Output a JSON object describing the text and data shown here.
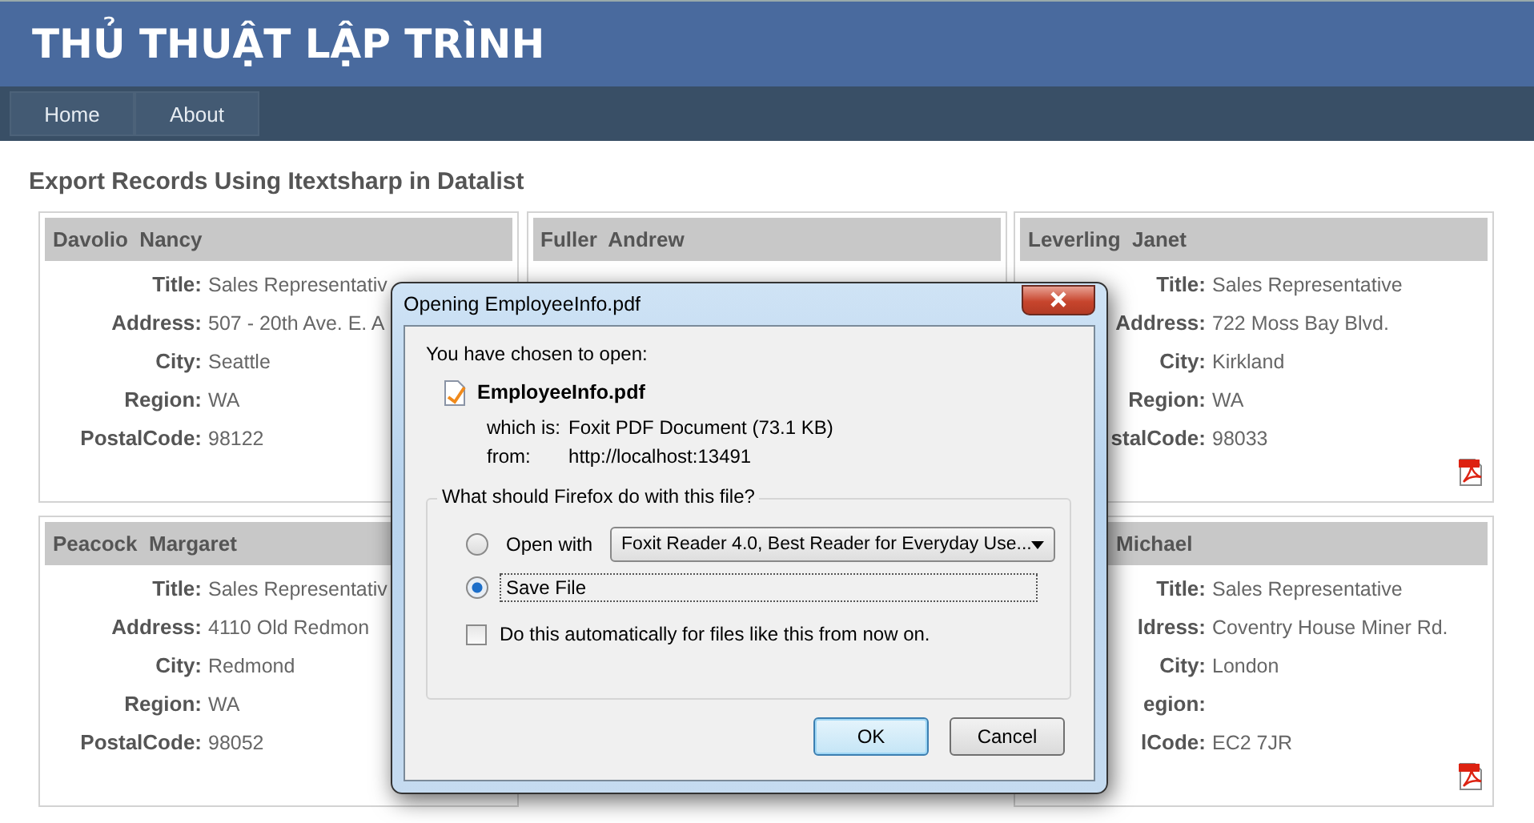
{
  "site": {
    "title": "THỦ THUẬT LẬP TRÌNH"
  },
  "nav": [
    {
      "label": "Home"
    },
    {
      "label": "About"
    }
  ],
  "heading": "Export Records Using Itextsharp in Datalist",
  "rows": [
    {
      "cards": [
        {
          "name": "Davolio  Nancy",
          "fields": [
            {
              "label": "Title:",
              "value": "Sales Representativ"
            },
            {
              "label": "Address:",
              "value": "507 - 20th Ave. E. A"
            },
            {
              "label": "City:",
              "value": "Seattle"
            },
            {
              "label": "Region:",
              "value": "WA"
            },
            {
              "label": "PostalCode:",
              "value": "98122"
            }
          ]
        },
        {
          "name": "Fuller  Andrew"
        },
        {
          "name": "Leverling  Janet",
          "has_pdf_link": true,
          "fields": [
            {
              "label": "Title:",
              "value": "Sales Representative"
            },
            {
              "label": "Address:",
              "value": "722 Moss Bay Blvd."
            },
            {
              "label": "City:",
              "value": "Kirkland"
            },
            {
              "label": "Region:",
              "value": "WA"
            },
            {
              "label": "stalCode:",
              "value": "98033"
            }
          ]
        }
      ]
    },
    {
      "cards": [
        {
          "name": "Peacock  Margaret",
          "fields": [
            {
              "label": "Title:",
              "value": "Sales Representativ"
            },
            {
              "label": "Address:",
              "value": "4110 Old Redmon"
            },
            {
              "label": "City:",
              "value": "Redmond"
            },
            {
              "label": "Region:",
              "value": "WA"
            },
            {
              "label": "PostalCode:",
              "value": "98052"
            }
          ]
        },
        {
          "name": "Michael",
          "has_pdf_link": true,
          "fields": [
            {
              "label": "Title:",
              "value": "Sales Representative"
            },
            {
              "label": "ldress:",
              "value": "Coventry House Miner Rd."
            },
            {
              "label": "City:",
              "value": "London"
            },
            {
              "label": "egion:"
            },
            {
              "label": "lCode:",
              "value": "EC2 7JR"
            }
          ]
        }
      ]
    }
  ],
  "dialog": {
    "title": "Opening EmployeeInfo.pdf",
    "intro": "You have chosen to open:",
    "file_name": "EmployeeInfo.pdf",
    "which_is_label": "which is:",
    "which_is_value": "Foxit PDF Document (73.1 KB)",
    "from_label": "from:",
    "from_value": "http://localhost:13491",
    "group_title": "What should Firefox do with this file?",
    "options": [
      {
        "label": "Open with",
        "selected": false,
        "app": "Foxit Reader 4.0, Best Reader for Everyday Use..."
      },
      {
        "label": "Save File",
        "selected": true
      }
    ],
    "remember": {
      "label": "Do this automatically for files like this from now on.",
      "checked": false
    },
    "buttons": [
      {
        "label": "OK",
        "default": true
      },
      {
        "label": "Cancel",
        "default": false
      }
    ]
  }
}
